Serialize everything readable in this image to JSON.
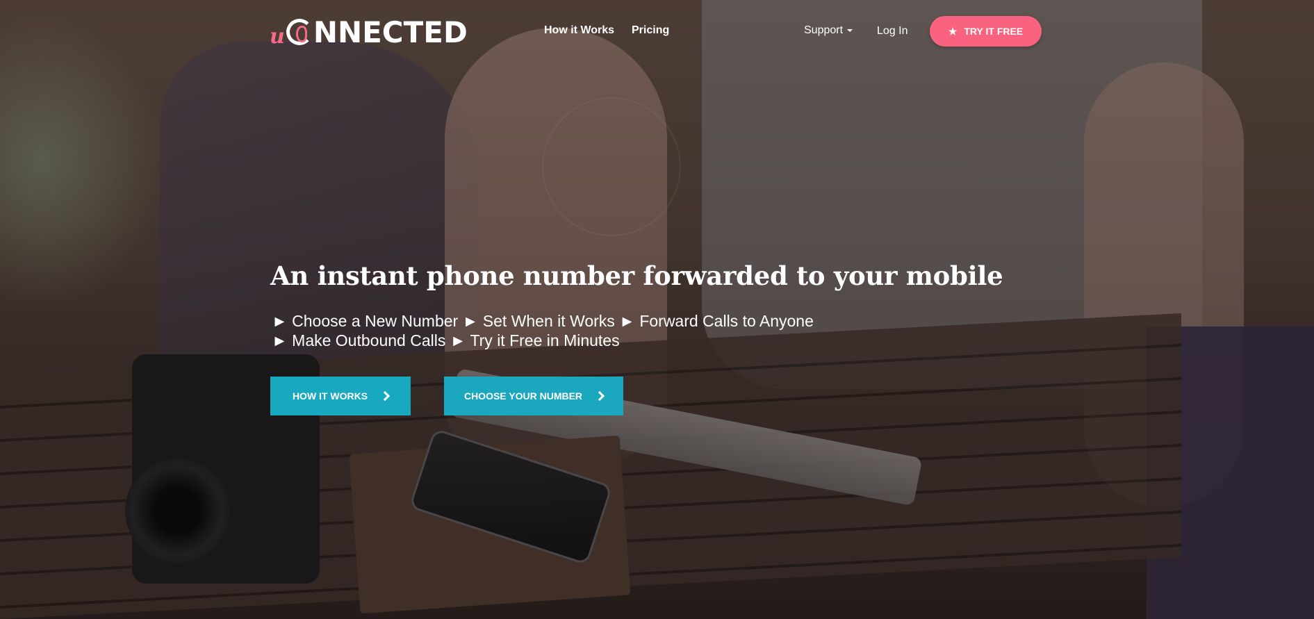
{
  "brand": {
    "logo_u": "u",
    "logo_rest": "NNECTED",
    "accent_pink": "#f9637f",
    "accent_teal": "#18a9c1"
  },
  "nav": {
    "how_it_works": "How it Works",
    "pricing": "Pricing",
    "support": "Support",
    "login": "Log In",
    "try_free": "TRY IT FREE",
    "try_free_icon": "star-icon"
  },
  "hero": {
    "title": "An instant phone number forwarded to your mobile",
    "line1": "► Choose a New Number ► Set When it Works ► Forward Calls to Anyone",
    "line2": "► Make Outbound Calls ► Try it Free in Minutes",
    "cta_how": "HOW IT WORKS",
    "cta_choose": "CHOOSE YOUR NUMBER"
  }
}
